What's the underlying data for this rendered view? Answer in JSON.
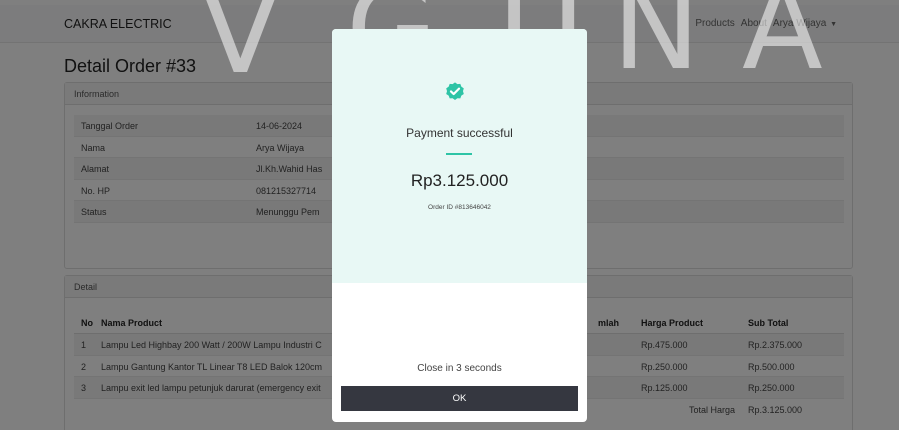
{
  "navbar": {
    "brand": "CAKRA ELECTRIC",
    "links": [
      "Products",
      "About"
    ],
    "user": "Arya Wijaya"
  },
  "page": {
    "title": "Detail Order #33"
  },
  "information": {
    "header": "Information",
    "rows": [
      {
        "label": "Tanggal Order",
        "value": "14-06-2024"
      },
      {
        "label": "Nama",
        "value": "Arya Wijaya"
      },
      {
        "label": "Alamat",
        "value": "Jl.Kh.Wahid Has"
      },
      {
        "label": "No. HP",
        "value": "081215327714"
      },
      {
        "label": "Status",
        "value": "Menunggu Pem"
      }
    ]
  },
  "detail": {
    "header": "Detail",
    "columns": {
      "no": "No",
      "name": "Nama Product",
      "qty": "mlah",
      "price": "Harga Product",
      "subtotal": "Sub Total"
    },
    "rows": [
      {
        "no": "1",
        "name": "Lampu Led Highbay 200 Watt / 200W Lampu Industri C",
        "price": "Rp.475.000",
        "subtotal": "Rp.2.375.000"
      },
      {
        "no": "2",
        "name": "Lampu Gantung Kantor TL Linear T8 LED Balok 120cm",
        "price": "Rp.250.000",
        "subtotal": "Rp.500.000"
      },
      {
        "no": "3",
        "name": "Lampu exit led lampu petunjuk darurat (emergency exit",
        "price": "Rp.125.000",
        "subtotal": "Rp.250.000"
      }
    ],
    "total_label": "Total Harga",
    "total_value": "Rp.3.125.000"
  },
  "watermark": {
    "letters": [
      "V",
      "G",
      "U",
      "N",
      "A"
    ]
  },
  "modal": {
    "icon": "check-badge-icon",
    "title": "Payment successful",
    "amount": "Rp3.125.000",
    "order_id": "Order ID #813646042",
    "close_text": "Close in 3 seconds",
    "ok_label": "OK"
  },
  "colors": {
    "modal_top_bg": "#e8f8f5",
    "accent": "#2ec4a6",
    "ok_button": "#353740"
  }
}
